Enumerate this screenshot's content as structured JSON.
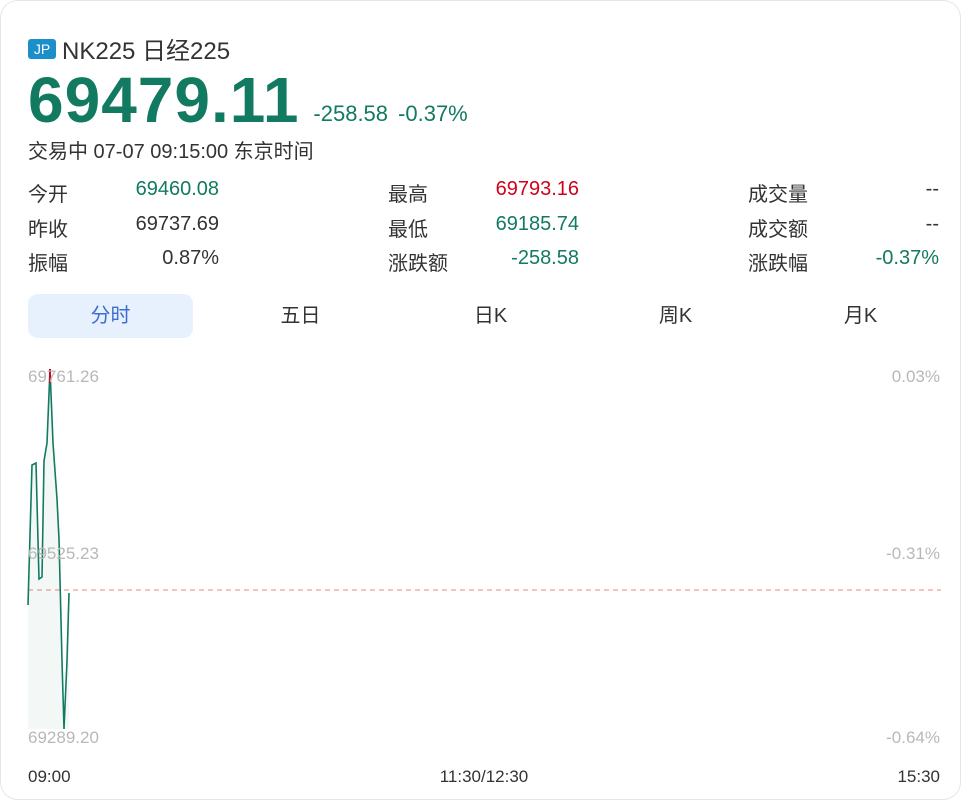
{
  "header": {
    "badge": "JP",
    "title": "NK225 日经225",
    "price": "69479.11",
    "change": "-258.58",
    "change_pct": "-0.37%",
    "status": "交易中 07-07 09:15:00 东京时间"
  },
  "stats": {
    "open_label": "今开",
    "open_value": "69460.08",
    "prev_close_label": "昨收",
    "prev_close_value": "69737.69",
    "amplitude_label": "振幅",
    "amplitude_value": "0.87%",
    "high_label": "最高",
    "high_value": "69793.16",
    "low_label": "最低",
    "low_value": "69185.74",
    "change_amt_label": "涨跌额",
    "change_amt_value": "-258.58",
    "volume_label": "成交量",
    "volume_value": "--",
    "turnover_label": "成交额",
    "turnover_value": "--",
    "change_pct_label": "涨跌幅",
    "change_pct_value": "-0.37%"
  },
  "tabs": [
    "分时",
    "五日",
    "日K",
    "周K",
    "月K"
  ],
  "active_tab": "分时",
  "chart": {
    "y_top": "69761.26",
    "y_mid": "69525.23",
    "y_bottom": "69289.20",
    "pct_top": "0.03%",
    "pct_mid": "-0.31%",
    "pct_bottom": "-0.64%",
    "x_start": "09:00",
    "x_mid": "11:30/12:30",
    "x_end": "15:30"
  },
  "colors": {
    "down": "#127a60",
    "up": "#d0021b",
    "tab_active_bg": "#e7f0fd",
    "tab_active_text": "#3d6dd1",
    "prev_close_line": "#f08080"
  }
}
